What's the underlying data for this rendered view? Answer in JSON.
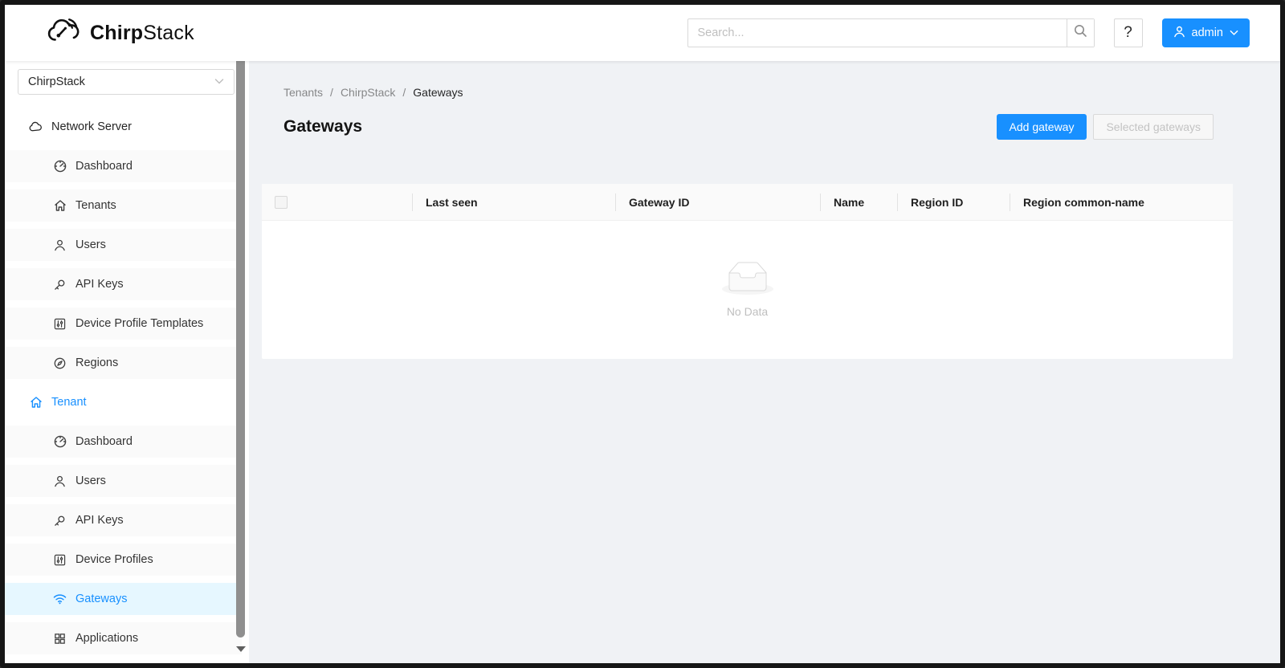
{
  "colors": {
    "accent": "#1890ff",
    "selected_menu_bg": "#e6f7ff",
    "layout_bg": "#f0f2f5",
    "table_header_bg": "#fafafa"
  },
  "header": {
    "logo_bold": "Chirp",
    "logo_light": "Stack",
    "search_placeholder": "Search...",
    "help_label": "?",
    "user_label": "admin"
  },
  "sidebar": {
    "org_select_value": "ChirpStack",
    "network_server": {
      "label": "Network Server",
      "items": [
        "Dashboard",
        "Tenants",
        "Users",
        "API Keys",
        "Device Profile Templates",
        "Regions"
      ]
    },
    "tenant": {
      "label": "Tenant",
      "items": [
        "Dashboard",
        "Users",
        "API Keys",
        "Device Profiles",
        "Gateways",
        "Applications"
      ],
      "selected_item": "Gateways"
    }
  },
  "main": {
    "breadcrumb": [
      "Tenants",
      "ChirpStack",
      "Gateways"
    ],
    "breadcrumb_separator": "/",
    "title": "Gateways",
    "add_button": "Add gateway",
    "selected_button": "Selected gateways",
    "table": {
      "columns": [
        "Last seen",
        "Gateway ID",
        "Name",
        "Region ID",
        "Region common-name"
      ],
      "empty_text": "No Data"
    }
  },
  "icons": {
    "logo": "chirpstack-cloud-icon",
    "search": "magnifier-icon",
    "user": "user-icon",
    "select_chevron": "chevron-down-icon",
    "network_server_section": "cloud-icon",
    "tenant_section": "home-icon",
    "dashboard": "dashboard-icon",
    "tenants": "home-icon",
    "users": "user-icon",
    "api_keys": "key-icon",
    "device_profiles": "sliders-icon",
    "regions": "compass-icon",
    "gateways": "wifi-icon",
    "applications": "appstore-icon",
    "empty": "inbox-icon",
    "scroll_arrow": "caret-down-icon"
  }
}
